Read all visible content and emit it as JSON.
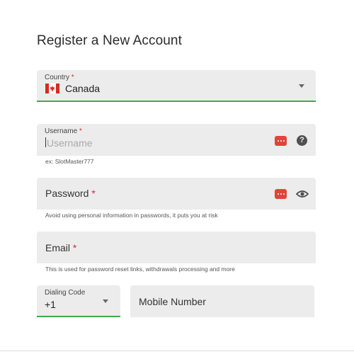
{
  "page": {
    "title": "Register a New Account"
  },
  "country": {
    "label": "Country",
    "required_marker": "*",
    "value": "Canada",
    "flag_icon": "canada-flag-icon"
  },
  "username": {
    "label": "Username",
    "required_marker": "*",
    "placeholder": "Username",
    "helper": "ex: SlotMaster777",
    "icons": [
      "password-manager-icon",
      "help-icon"
    ],
    "help_glyph": "?"
  },
  "password": {
    "label": "Password",
    "required_marker": "*",
    "helper": "Avoid using personal information in passwords, it puts you at risk",
    "icons": [
      "password-manager-icon",
      "eye-icon"
    ]
  },
  "email": {
    "label": "Email",
    "required_marker": "*",
    "helper": "This is used for password reset links, withdrawals processing and more"
  },
  "dialing_code": {
    "label": "Dialing Code",
    "value": "+1"
  },
  "mobile": {
    "label": "Mobile Number"
  },
  "colors": {
    "accent_green": "#3dab4f",
    "required_red": "#d62b2b",
    "field_bg": "#ececec"
  }
}
